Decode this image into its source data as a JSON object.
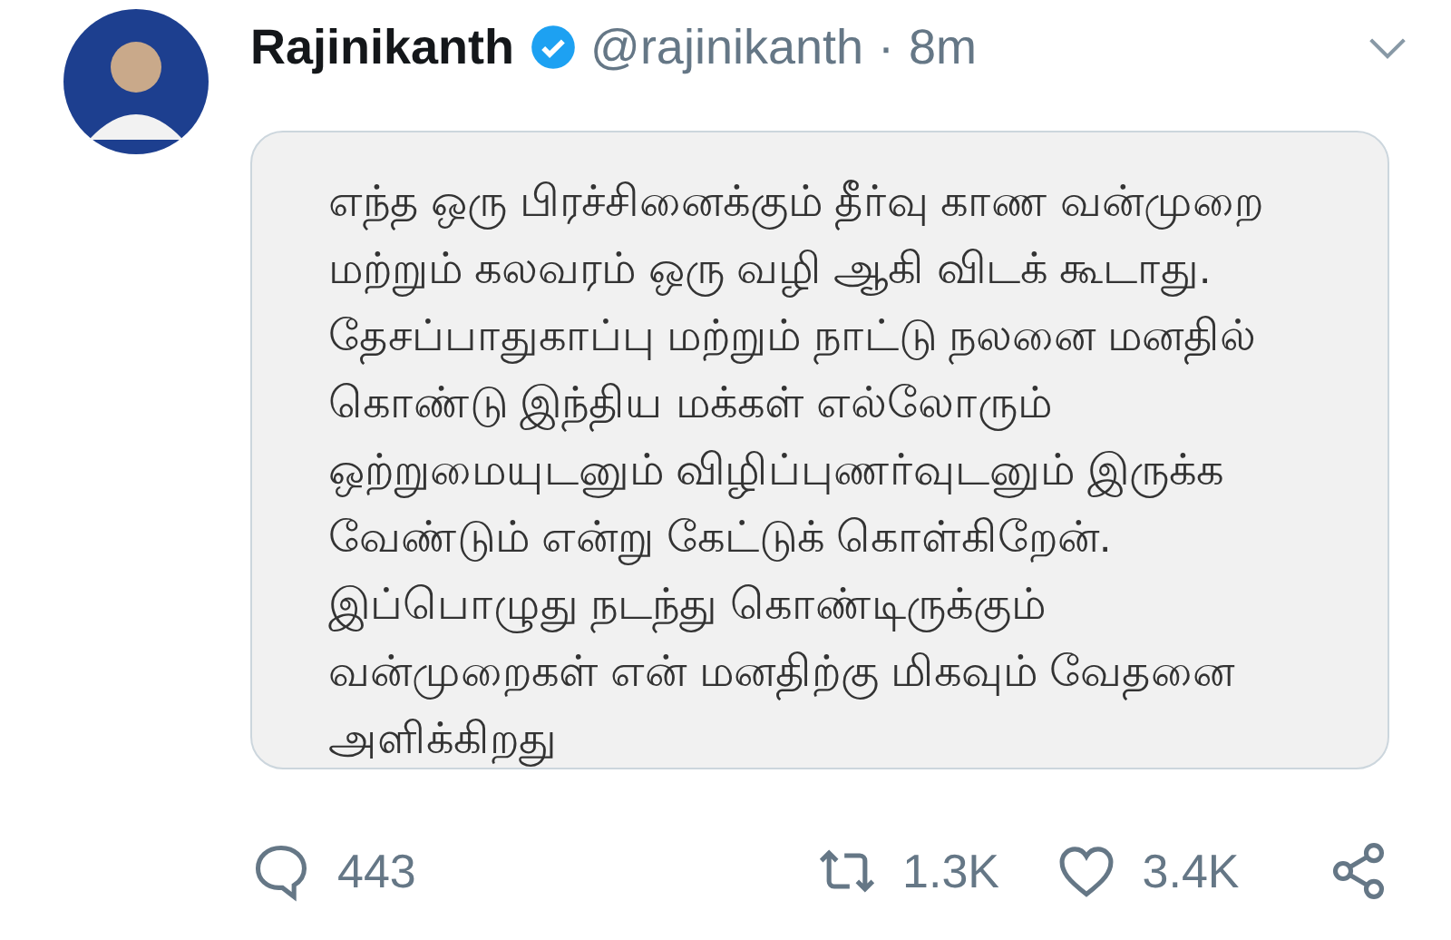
{
  "tweet": {
    "name": "Rajinikanth",
    "verified": true,
    "handle": "@rajinikanth",
    "separator": "·",
    "time": "8m",
    "image_text_lines": [
      "எந்த ஒரு பிரச்சினைக்கும் தீர்வு காண வன்முறை",
      "மற்றும் கலவரம் ஒரு வழி ஆகி விடக் கூடாது.",
      "தேசப்பாதுகாப்பு மற்றும் நாட்டு நலனை மனதில்",
      "கொண்டு இந்திய மக்கள் எல்லோரும்",
      "ஒற்றுமையுடனும் விழிப்புணர்வுடனும் இருக்க",
      "வேண்டும் என்று கேட்டுக் கொள்கிறேன்.",
      "இப்பொழுது நடந்து கொண்டிருக்கும்",
      "வன்முறைகள் என் மனதிற்கு மிகவும் வேதனை",
      "அளிக்கிறது"
    ],
    "actions": [
      {
        "kind": "reply",
        "count": "443"
      },
      {
        "kind": "retweet",
        "count": "1.3K"
      },
      {
        "kind": "like",
        "count": "3.4K"
      },
      {
        "kind": "share"
      }
    ]
  }
}
